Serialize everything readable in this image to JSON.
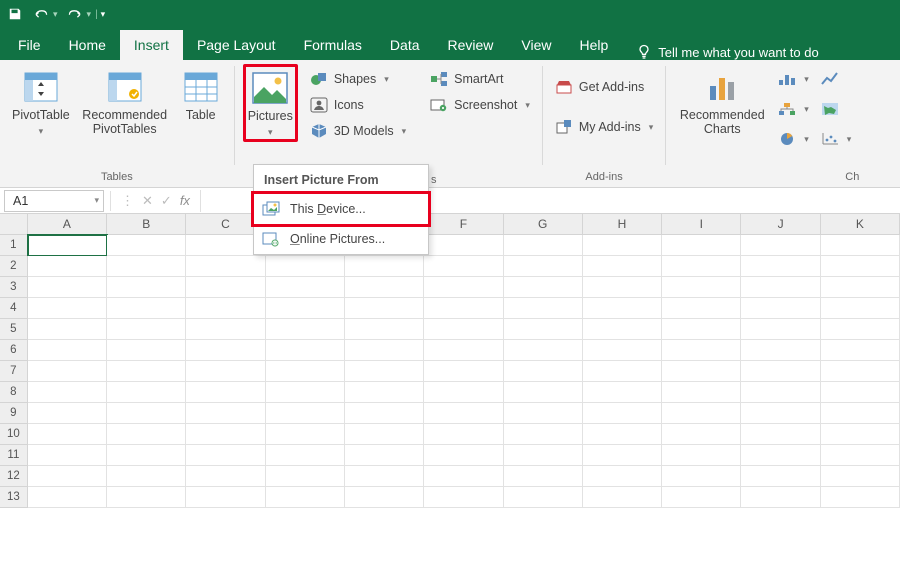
{
  "app": {
    "qat_icons": [
      "save-icon",
      "undo-icon",
      "redo-icon",
      "customize-qat-icon"
    ]
  },
  "tabs": {
    "file": "File",
    "home": "Home",
    "insert": "Insert",
    "pagelayout": "Page Layout",
    "formulas": "Formulas",
    "data": "Data",
    "review": "Review",
    "view": "View",
    "help": "Help",
    "tellme": "Tell me what you want to do",
    "active": "insert"
  },
  "ribbon": {
    "groups": {
      "tables": {
        "name": "Tables",
        "pivottable": "PivotTable",
        "recommended_pivot": "Recommended\nPivotTables",
        "table": "Table"
      },
      "illustrations": {
        "pictures": "Pictures",
        "shapes": "Shapes",
        "icons": "Icons",
        "models": "3D Models",
        "smartart": "SmartArt",
        "screenshot": "Screenshot",
        "trailing_label": "s"
      },
      "addins": {
        "name": "Add-ins",
        "get": "Get Add-ins",
        "my": "My Add-ins"
      },
      "charts": {
        "name": "Ch",
        "recommended": "Recommended\nCharts"
      }
    }
  },
  "dropdown": {
    "title": "Insert Picture From",
    "this_device": "This Device...",
    "this_device_key": "D",
    "online": "Online Pictures...",
    "online_key": "O"
  },
  "formula_bar": {
    "namebox": "A1"
  },
  "grid": {
    "columns": [
      "A",
      "B",
      "C",
      "D",
      "E",
      "F",
      "G",
      "H",
      "I",
      "J",
      "K"
    ],
    "rows": [
      "1",
      "2",
      "3",
      "4",
      "5",
      "6",
      "7",
      "8",
      "9",
      "10",
      "11",
      "12",
      "13"
    ],
    "selected": "A1"
  },
  "colors": {
    "brand": "#117244",
    "highlight": "#e8001e"
  }
}
